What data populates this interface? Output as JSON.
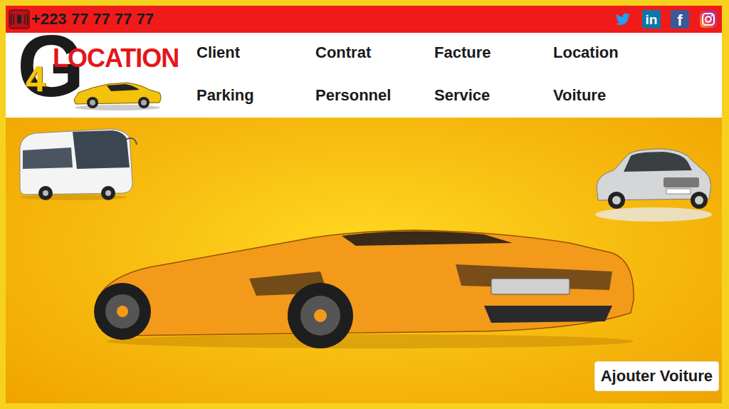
{
  "topbar": {
    "phone": "+223 77 77 77 77",
    "social": [
      {
        "label": "in"
      },
      {
        "label": "f"
      }
    ]
  },
  "logo": {
    "letter": "G",
    "number": "4",
    "word": "LOCATION"
  },
  "nav": [
    {
      "label": "Client"
    },
    {
      "label": "Contrat"
    },
    {
      "label": "Facture"
    },
    {
      "label": "Location"
    },
    {
      "label": "Parking"
    },
    {
      "label": "Personnel"
    },
    {
      "label": "Service"
    },
    {
      "label": "Voiture"
    }
  ],
  "hero": {
    "button": "Ajouter Voiture"
  }
}
